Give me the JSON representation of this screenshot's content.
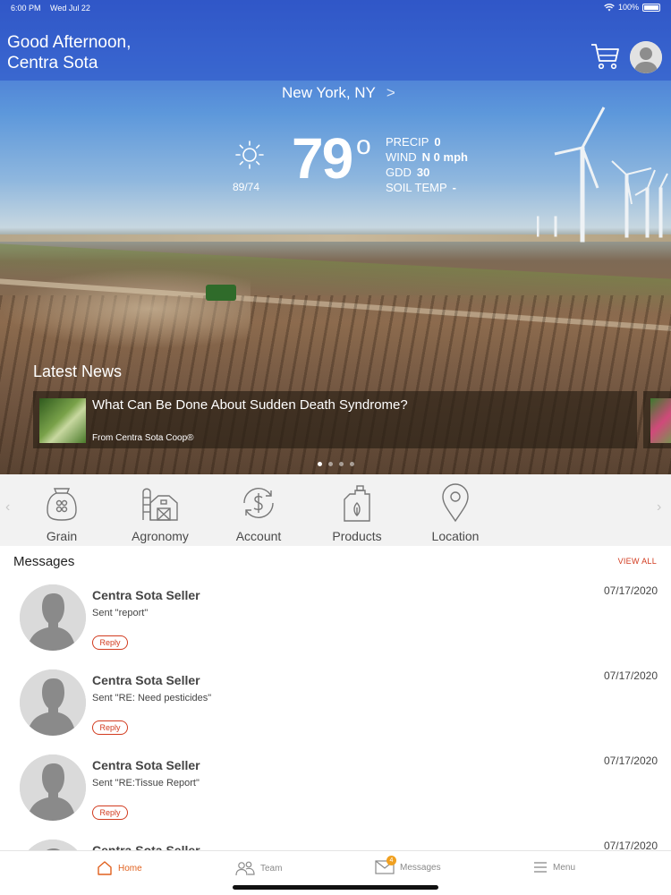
{
  "status_bar": {
    "time": "6:00 PM",
    "date": "Wed Jul 22",
    "battery": "100%"
  },
  "header": {
    "greeting_line1": "Good Afternoon,",
    "greeting_line2": "Centra Sota"
  },
  "weather": {
    "location": "New York, NY",
    "temperature": "79",
    "degree_symbol": "o",
    "hi_lo": "89/74",
    "stats": [
      {
        "label": "PRECIP",
        "value": "0"
      },
      {
        "label": "WIND",
        "value": "N 0 mph"
      },
      {
        "label": "GDD",
        "value": "30"
      },
      {
        "label": "SOIL TEMP",
        "value": "-"
      }
    ]
  },
  "news": {
    "section_title": "Latest News",
    "cards": [
      {
        "headline": "What Can Be Done About Sudden Death Syndrome?",
        "source": "From Centra Sota Coop®"
      }
    ],
    "page_count": 4,
    "active_page": 0
  },
  "quick_nav": [
    {
      "label": "Grain",
      "icon": "grain-bag-icon"
    },
    {
      "label": "Agronomy",
      "icon": "barn-silo-icon"
    },
    {
      "label": "Account",
      "icon": "dollar-cycle-icon"
    },
    {
      "label": "Products",
      "icon": "jug-icon"
    },
    {
      "label": "Location",
      "icon": "map-pin-icon"
    }
  ],
  "messages": {
    "title": "Messages",
    "view_all": "VIEW ALL",
    "reply_label": "Reply",
    "items": [
      {
        "sender": "Centra Sota Seller",
        "text": "Sent \"report\"",
        "date": "07/17/2020"
      },
      {
        "sender": "Centra Sota Seller",
        "text": "Sent \"RE: Need pesticides\"",
        "date": "07/17/2020"
      },
      {
        "sender": "Centra Sota Seller",
        "text": "Sent \"RE:Tissue Report\"",
        "date": "07/17/2020"
      },
      {
        "sender": "Centra Sota Seller",
        "text": "",
        "date": "07/17/2020"
      }
    ]
  },
  "tabs": [
    {
      "label": "Home",
      "icon": "home-icon",
      "active": true
    },
    {
      "label": "Team",
      "icon": "team-icon",
      "active": false
    },
    {
      "label": "Messages",
      "icon": "envelope-icon",
      "active": false,
      "badge": "4"
    },
    {
      "label": "Menu",
      "icon": "hamburger-icon",
      "active": false
    }
  ],
  "colors": {
    "accent": "#d23b1f",
    "tab_active": "#e0611f",
    "badge": "#f0a020"
  }
}
